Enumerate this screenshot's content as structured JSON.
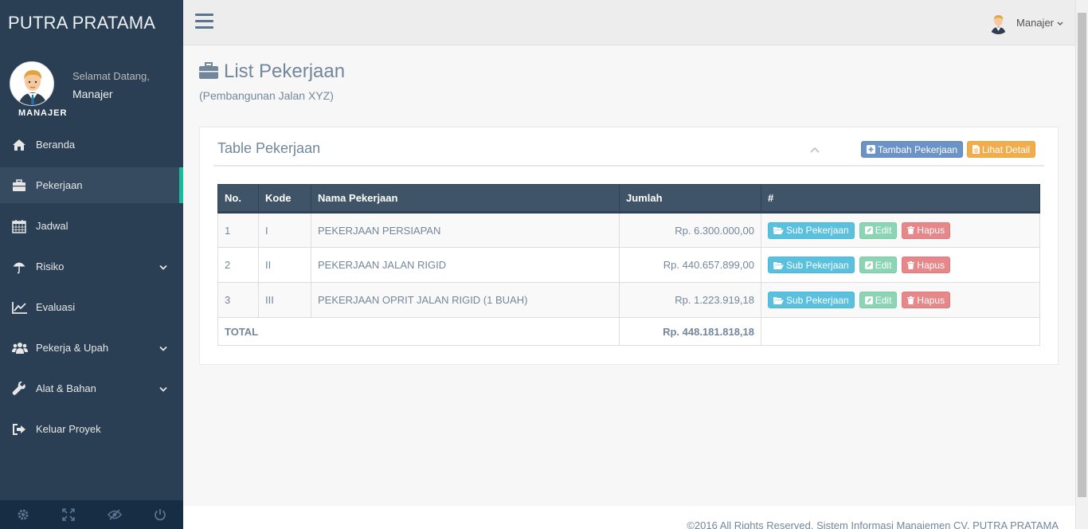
{
  "app": {
    "brand": "PUTRA PRATAMA"
  },
  "profile": {
    "role": "MANAJER",
    "welcome": "Selamat Datang,",
    "name": "Manajer"
  },
  "menu": [
    {
      "label": "Beranda",
      "icon": "home-icon",
      "chevron": false,
      "active": false
    },
    {
      "label": "Pekerjaan",
      "icon": "briefcase-icon",
      "chevron": false,
      "active": true
    },
    {
      "label": "Jadwal",
      "icon": "calendar-icon",
      "chevron": false,
      "active": false
    },
    {
      "label": "Risiko",
      "icon": "umbrella-icon",
      "chevron": true,
      "active": false
    },
    {
      "label": "Evaluasi",
      "icon": "line-chart-icon",
      "chevron": false,
      "active": false
    },
    {
      "label": "Pekerja & Upah",
      "icon": "users-icon",
      "chevron": true,
      "active": false
    },
    {
      "label": "Alat & Bahan",
      "icon": "wrench-icon",
      "chevron": true,
      "active": false
    },
    {
      "label": "Keluar Proyek",
      "icon": "sign-out-icon",
      "chevron": false,
      "active": false
    }
  ],
  "sidebar_footer": [
    "settings-icon",
    "fullscreen-icon",
    "lock-icon",
    "power-icon"
  ],
  "topbar": {
    "user_name": "Manajer"
  },
  "page": {
    "title": "List Pekerjaan",
    "subtitle": "(Pembangunan Jalan XYZ)"
  },
  "panel": {
    "title": "Table Pekerjaan",
    "add_button": "Tambah Pekerjaan",
    "detail_button": "Lihat Detail"
  },
  "table": {
    "headers": [
      "No.",
      "Kode",
      "Nama Pekerjaan",
      "Jumlah",
      "#"
    ],
    "rows": [
      {
        "no": "1",
        "kode": "I",
        "nama": "PEKERJAAN PERSIAPAN",
        "jumlah": "Rp. 6.300.000,00"
      },
      {
        "no": "2",
        "kode": "II",
        "nama": "PEKERJAAN JALAN RIGID",
        "jumlah": "Rp. 440.657.899,00"
      },
      {
        "no": "3",
        "kode": "III",
        "nama": "PEKERJAAN OPRIT JALAN RIGID (1 BUAH)",
        "jumlah": "Rp. 1.223.919,18"
      }
    ],
    "row_actions": {
      "sub": "Sub Pekerjaan",
      "edit": "Edit",
      "delete": "Hapus"
    },
    "total_label": "TOTAL",
    "total_value": "Rp. 448.181.818,18"
  },
  "footer": {
    "text": "©2016 All Rights Reserved. Sistem Informasi Manajemen CV. PUTRA PRATAMA"
  },
  "colors": {
    "sidebar": "#2a3f54",
    "accent": "#1abb9c",
    "table_header": "#405467"
  }
}
